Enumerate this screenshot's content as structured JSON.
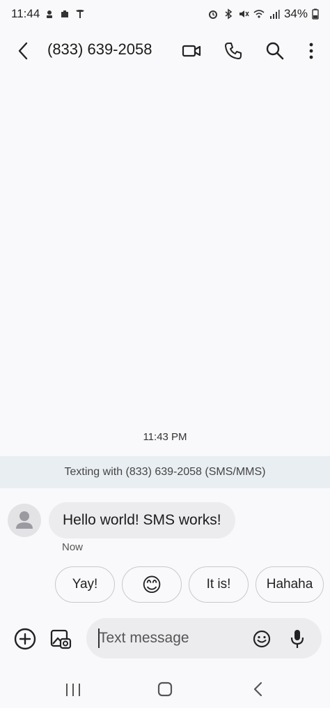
{
  "status": {
    "time": "11:44",
    "battery": "34%"
  },
  "header": {
    "contact": "(833) 639-2058"
  },
  "conversation": {
    "timestamp": "11:43 PM",
    "banner": "Texting with (833) 639-2058 (SMS/MMS)",
    "message": {
      "text": "Hello world! SMS works!",
      "time": "Now"
    }
  },
  "smart_replies": [
    "Yay!",
    "😊",
    "It is!",
    "Hahaha"
  ],
  "composer": {
    "placeholder": "Text message"
  },
  "colors": {
    "background": "#f9f9fb",
    "bubble": "#ececef",
    "banner": "#e9eef2"
  },
  "icons": {
    "back": "chevron-left-icon",
    "video": "video-call-icon",
    "phone": "phone-icon",
    "search": "search-icon",
    "more": "more-vert-icon",
    "add": "add-circle-icon",
    "gallery": "gallery-icon",
    "emoji": "emoji-icon",
    "mic": "mic-icon"
  }
}
